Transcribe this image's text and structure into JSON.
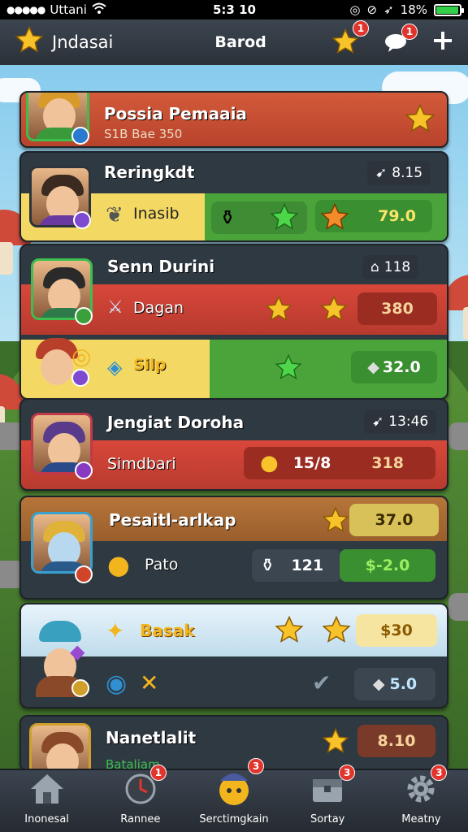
{
  "status_bar": {
    "carrier": "Uttani",
    "time": "5:3 10",
    "battery": "18%"
  },
  "header": {
    "title": "Jndasai",
    "center_label": "Barod",
    "notif_badge": "1",
    "chat_badge": "1"
  },
  "cards": [
    {
      "name": "Possia Pemaaia",
      "subtitle": "S1B Bae 350"
    },
    {
      "name": "Reringkdt",
      "chip": "8.15",
      "label": "Inasib",
      "value": "79.0"
    },
    {
      "name": "Senn Durini",
      "chip": "118",
      "label": "Dagan",
      "value": "380",
      "label2": "Silp",
      "value2": "32.0"
    },
    {
      "name": "Jengiat Doroha",
      "chip": "13:46",
      "label": "Simdbari",
      "value": "15/8",
      "value_b": "318"
    },
    {
      "name": "Pesaitl-arlkap",
      "value": "37.0",
      "label": "Pato",
      "count": "121",
      "value2": "$-2.0"
    },
    {
      "name": "Basak",
      "value": "$30",
      "value2": "5.0"
    },
    {
      "name": "Nanetlalit",
      "value": "8.10",
      "subtitle": "Bataliam"
    }
  ],
  "bottom_nav": [
    {
      "label": "Inonesal",
      "icon": "home-icon"
    },
    {
      "label": "Rannee",
      "icon": "clock-icon",
      "badge": "1"
    },
    {
      "label": "Serctimgkain",
      "icon": "hero-icon",
      "badge": "3"
    },
    {
      "label": "Sortay",
      "icon": "chest-icon",
      "badge": "3"
    },
    {
      "label": "Meatny",
      "icon": "gear-icon",
      "badge": "3"
    }
  ],
  "colors": {
    "red": "#c8402f",
    "green": "#4aa43a",
    "yellow": "#f3d964",
    "dark": "#2f3942",
    "gold": "#f7c22a"
  }
}
